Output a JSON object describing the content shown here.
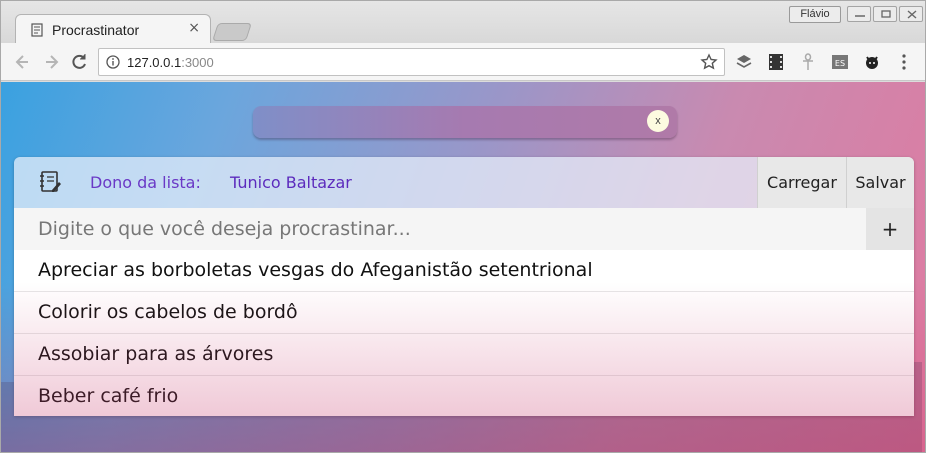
{
  "browser": {
    "tab_title": "Procrastinator",
    "tab_close": "×",
    "user_name": "Flávio",
    "url_host": "127.0.0.1",
    "url_port": ":3000"
  },
  "app": {
    "search_placeholder": "",
    "search_clear_label": "x",
    "owner_label": "Dono da lista:",
    "owner_name": "Tunico Baltazar",
    "load_button": "Carregar",
    "save_button": "Salvar",
    "new_item_placeholder": "Digite o que você deseja procrastinar...",
    "add_button": "+",
    "items": [
      {
        "label": "Apreciar as borboletas vesgas do Afeganistão setentrional"
      },
      {
        "label": "Colorir os cabelos de bordô"
      },
      {
        "label": "Assobiar para as árvores"
      },
      {
        "label": "Beber café frio"
      }
    ]
  }
}
